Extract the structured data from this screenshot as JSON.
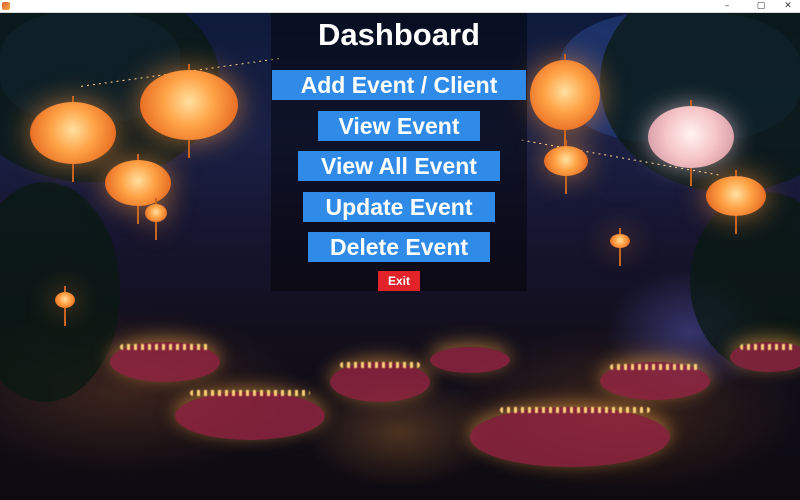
{
  "window": {
    "controls": {
      "minimize": "–",
      "maximize": "▢",
      "close": "✕"
    }
  },
  "dashboard": {
    "title": "Dashboard",
    "buttons": {
      "add": "Add Event / Client",
      "view": "View Event",
      "view_all": "View All Event",
      "update": "Update Event",
      "delete": "Delete Event"
    },
    "exit": "Exit"
  },
  "colors": {
    "button_bg": "#2f8ae8",
    "exit_bg": "#e2232a",
    "title_text": "#ffffff"
  },
  "background": "festive-garden-event-photo"
}
